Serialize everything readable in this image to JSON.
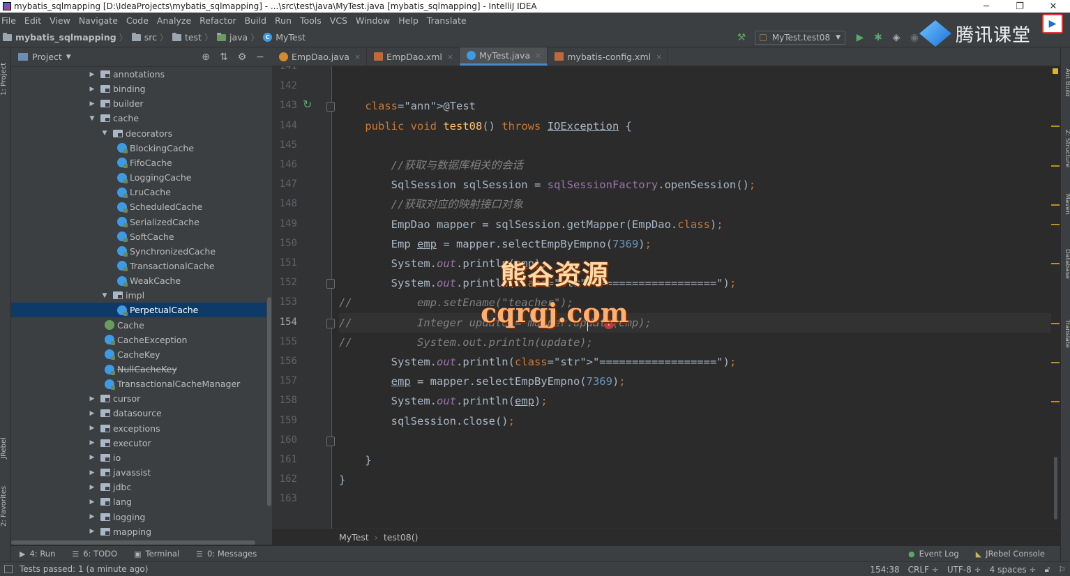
{
  "window": {
    "title": "mybatis_sqlmapping [D:\\IdeaProjects\\mybatis_sqlmapping] - ...\\src\\test\\java\\MyTest.java [mybatis_sqlmapping] - IntelliJ IDEA",
    "minimize": "─",
    "restore": "❐",
    "close": "✕"
  },
  "menu": [
    "File",
    "Edit",
    "View",
    "Navigate",
    "Code",
    "Analyze",
    "Refactor",
    "Build",
    "Run",
    "Tools",
    "VCS",
    "Window",
    "Help",
    "Translate"
  ],
  "navbar": {
    "crumbs": [
      "mybatis_sqlmapping",
      "src",
      "test",
      "java",
      "MyTest"
    ],
    "sep": "〉",
    "run_config": "MyTest.test08"
  },
  "brand": {
    "text": "腾讯课堂"
  },
  "left_strip": {
    "project_tab": "1: Project",
    "jrebel_tab": "JRebel",
    "favorites_tab": "2: Favorites"
  },
  "right_strip": {
    "ant_tab": "Ant Build",
    "structure_tab": "Z: Structure",
    "maven_tab": "Maven",
    "database_tab": "Database",
    "translate_tab": "Translate"
  },
  "project_panel": {
    "title": "Project",
    "tree": [
      {
        "label": "annotations",
        "kind": "pkg",
        "arrow": "▶",
        "depth": 0
      },
      {
        "label": "binding",
        "kind": "pkg",
        "arrow": "▶",
        "depth": 0
      },
      {
        "label": "builder",
        "kind": "pkg",
        "arrow": "▶",
        "depth": 0
      },
      {
        "label": "cache",
        "kind": "pkg",
        "arrow": "▼",
        "depth": 0
      },
      {
        "label": "decorators",
        "kind": "pkg",
        "arrow": "▼",
        "depth": 1
      },
      {
        "label": "BlockingCache",
        "kind": "cls",
        "arrow": "",
        "depth": 2
      },
      {
        "label": "FifoCache",
        "kind": "cls",
        "arrow": "",
        "depth": 2
      },
      {
        "label": "LoggingCache",
        "kind": "cls",
        "arrow": "",
        "depth": 2
      },
      {
        "label": "LruCache",
        "kind": "cls",
        "arrow": "",
        "depth": 2
      },
      {
        "label": "ScheduledCache",
        "kind": "cls",
        "arrow": "",
        "depth": 2
      },
      {
        "label": "SerializedCache",
        "kind": "cls",
        "arrow": "",
        "depth": 2
      },
      {
        "label": "SoftCache",
        "kind": "cls",
        "arrow": "",
        "depth": 2
      },
      {
        "label": "SynchronizedCache",
        "kind": "cls",
        "arrow": "",
        "depth": 2
      },
      {
        "label": "TransactionalCache",
        "kind": "cls",
        "arrow": "",
        "depth": 2
      },
      {
        "label": "WeakCache",
        "kind": "cls",
        "arrow": "",
        "depth": 2
      },
      {
        "label": "impl",
        "kind": "pkg",
        "arrow": "▼",
        "depth": 1
      },
      {
        "label": "PerpetualCache",
        "kind": "cls",
        "arrow": "",
        "depth": 2,
        "selected": true
      },
      {
        "label": "Cache",
        "kind": "int",
        "arrow": "",
        "depth": 1
      },
      {
        "label": "CacheException",
        "kind": "cls",
        "arrow": "",
        "depth": 1
      },
      {
        "label": "CacheKey",
        "kind": "cls",
        "arrow": "",
        "depth": 1
      },
      {
        "label": "NullCacheKey",
        "kind": "cls",
        "arrow": "",
        "depth": 1,
        "deprecated": true
      },
      {
        "label": "TransactionalCacheManager",
        "kind": "cls",
        "arrow": "",
        "depth": 1
      },
      {
        "label": "cursor",
        "kind": "pkg",
        "arrow": "▶",
        "depth": 0
      },
      {
        "label": "datasource",
        "kind": "pkg",
        "arrow": "▶",
        "depth": 0
      },
      {
        "label": "exceptions",
        "kind": "pkg",
        "arrow": "▶",
        "depth": 0
      },
      {
        "label": "executor",
        "kind": "pkg",
        "arrow": "▶",
        "depth": 0
      },
      {
        "label": "io",
        "kind": "pkg",
        "arrow": "▶",
        "depth": 0
      },
      {
        "label": "javassist",
        "kind": "pkg",
        "arrow": "▶",
        "depth": 0
      },
      {
        "label": "jdbc",
        "kind": "pkg",
        "arrow": "▶",
        "depth": 0
      },
      {
        "label": "lang",
        "kind": "pkg",
        "arrow": "▶",
        "depth": 0
      },
      {
        "label": "logging",
        "kind": "pkg",
        "arrow": "▶",
        "depth": 0
      },
      {
        "label": "mapping",
        "kind": "pkg",
        "arrow": "▶",
        "depth": 0
      }
    ]
  },
  "editor_tabs": [
    {
      "label": "EmpDao.java",
      "icon": "java-interface-icon",
      "active": false
    },
    {
      "label": "EmpDao.xml",
      "icon": "xml-icon",
      "active": false
    },
    {
      "label": "MyTest.java",
      "icon": "class-icon",
      "active": true
    },
    {
      "label": "mybatis-config.xml",
      "icon": "xml-icon",
      "active": false
    }
  ],
  "editor": {
    "first_line": 141,
    "current_line": 154,
    "lines": [
      "",
      "",
      "    @Test",
      "    public void test08() throws IOException {",
      "",
      "        //获取与数据库相关的会话",
      "        SqlSession sqlSession = sqlSessionFactory.openSession();",
      "        //获取对应的映射接口对象",
      "        EmpDao mapper = sqlSession.getMapper(EmpDao.class);",
      "        Emp emp = mapper.selectEmpByEmpno(7369);",
      "        System.out.println(emp);",
      "        System.out.println(\"==================\");",
      "//          emp.setEname(\"teacher\");",
      "//          Integer update = mapper.update(emp);",
      "//          System.out.println(update);",
      "        System.out.println(\"==================\");",
      "        emp = mapper.selectEmpByEmpno(7369);",
      "        System.out.println(emp);",
      "        sqlSession.close();",
      "",
      "    }",
      "}",
      ""
    ],
    "breadcrumb": [
      "MyTest",
      "test08()"
    ]
  },
  "watermark": {
    "line1": "熊谷资源",
    "line2": "cqrqj.com"
  },
  "toolwindows": [
    {
      "label": "4: Run",
      "icon": "▶"
    },
    {
      "label": "6: TODO",
      "icon": "☰"
    },
    {
      "label": "Terminal",
      "icon": "▣"
    },
    {
      "label": "0: Messages",
      "icon": "☰"
    }
  ],
  "toolwindows_right": [
    {
      "label": "Event Log",
      "icon": "●"
    },
    {
      "label": "JRebel Console",
      "icon": "◣"
    }
  ],
  "status": {
    "message": "Tests passed: 1 (a minute ago)",
    "position": "154:38",
    "line_sep": "CRLF ÷",
    "encoding": "UTF-8 ÷",
    "indent": "4 spaces ÷"
  },
  "colors": {
    "accent": "#4a88c7",
    "selection": "#0d3a67",
    "editor_bg": "#2b2b2b",
    "panel_bg": "#3c3f41"
  }
}
